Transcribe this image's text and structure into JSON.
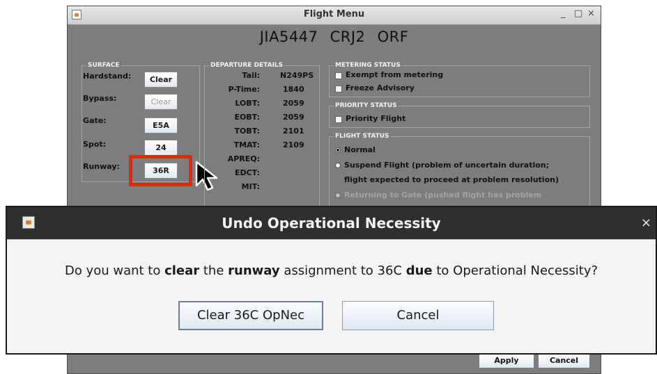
{
  "flight_menu": {
    "title": "Flight Menu",
    "controls": {
      "minimize": "_",
      "maximize": "□",
      "close": "×"
    },
    "header": "JIA5447  CRJ2  ORF",
    "surface": {
      "title": "SURFACE",
      "rows": [
        {
          "label": "Hardstand:",
          "button": "Clear"
        },
        {
          "label": "Bypass:",
          "button": "Clear"
        },
        {
          "label": "Gate:",
          "button": "E5A"
        },
        {
          "label": "Spot:",
          "button": "24"
        },
        {
          "label": "Runway:",
          "button": "36R"
        }
      ]
    },
    "departure_details": {
      "title": "DEPARTURE DETAILS",
      "rows": [
        {
          "label": "Tail:",
          "value": "N249PS"
        },
        {
          "label": "P-Time:",
          "value": "1840"
        },
        {
          "label": "LOBT:",
          "value": "2059"
        },
        {
          "label": "EOBT:",
          "value": "2059"
        },
        {
          "label": "TOBT:",
          "value": "2101"
        },
        {
          "label": "TMAT:",
          "value": "2109"
        },
        {
          "label": "APREQ:",
          "value": ""
        },
        {
          "label": "EDCT:",
          "value": ""
        },
        {
          "label": "MIT:",
          "value": ""
        }
      ]
    },
    "metering_status": {
      "title": "METERING STATUS",
      "options": [
        "Exempt from metering",
        "Freeze Advisory"
      ]
    },
    "priority_status": {
      "title": "PRIORITY STATUS",
      "options": [
        "Priority Flight"
      ]
    },
    "flight_status": {
      "title": "FLIGHT STATUS",
      "options": [
        "Normal",
        "Suspend Flight (problem of uncertain duration;",
        "flight expected to proceed at problem resolution)",
        "Returning to Gate (pushed flight has problem"
      ]
    },
    "buttons": {
      "apply": "Apply",
      "cancel": "Cancel"
    }
  },
  "dialog": {
    "title": "Undo Operational Necessity",
    "close": "×",
    "message_start": "Do you want to ",
    "message_clear": "clear",
    "message_the": " the ",
    "message_runway": "runway",
    "message_mid": " assignment to 36C ",
    "message_due": "due",
    "message_end": " to Operational Necessity?",
    "buttons": {
      "confirm": "Clear 36C OpNec",
      "cancel": "Cancel"
    }
  },
  "colors": {
    "highlight": "#e8260c",
    "window_bg": "#7d7d7d",
    "dialog_title_bg": "#2f2f2f"
  }
}
